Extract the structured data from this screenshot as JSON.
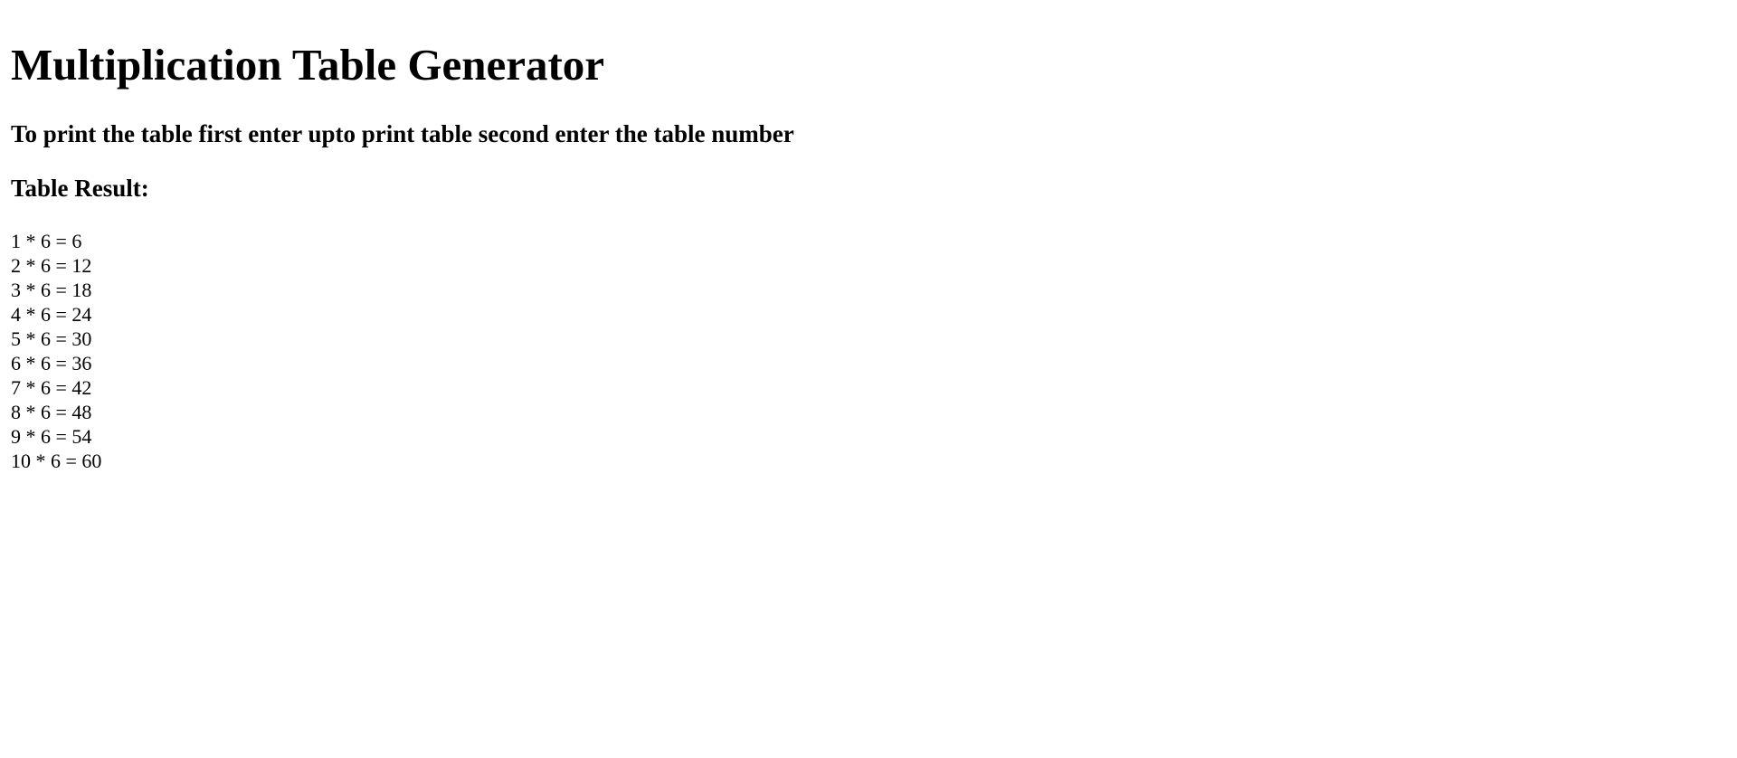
{
  "page": {
    "title": "Multiplication Table Generator",
    "instructions": "To print the table first enter upto print table second enter the table number",
    "result_heading": "Table Result:"
  },
  "results": [
    "1 * 6 = 6",
    "2 * 6 = 12",
    "3 * 6 = 18",
    "4 * 6 = 24",
    "5 * 6 = 30",
    "6 * 6 = 36",
    "7 * 6 = 42",
    "8 * 6 = 48",
    "9 * 6 = 54",
    "10 * 6 = 60"
  ]
}
